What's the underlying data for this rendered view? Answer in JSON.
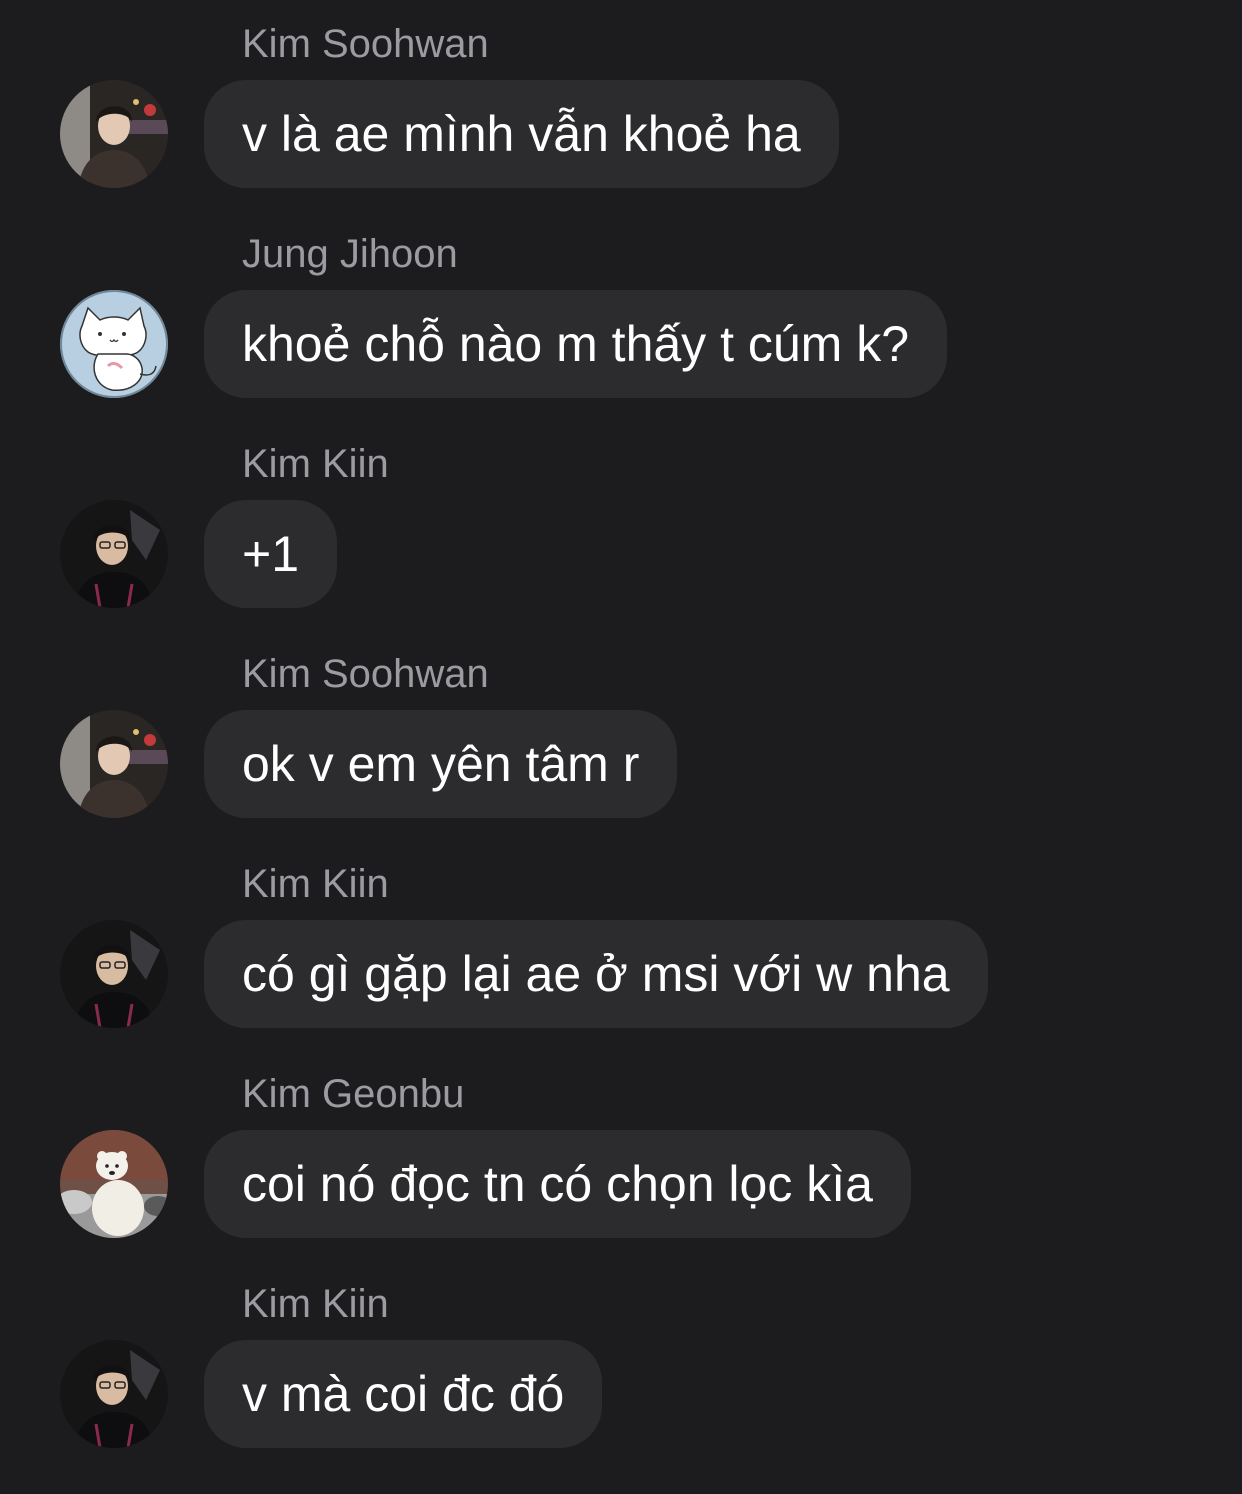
{
  "messages": [
    {
      "sender": "Kim Soohwan",
      "text": "v là ae mình vẫn khoẻ ha",
      "avatar": "avatar-kim-soohwan"
    },
    {
      "sender": "Jung Jihoon",
      "text": "khoẻ chỗ nào m thấy t cúm k?",
      "avatar": "avatar-jung-jihoon"
    },
    {
      "sender": "Kim Kiin",
      "text": "+1",
      "avatar": "avatar-kim-kiin"
    },
    {
      "sender": "Kim Soohwan",
      "text": "ok v em yên tâm r",
      "avatar": "avatar-kim-soohwan"
    },
    {
      "sender": "Kim Kiin",
      "text": "có gì gặp lại ae ở msi với w nha",
      "avatar": "avatar-kim-kiin"
    },
    {
      "sender": "Kim Geonbu",
      "text": "coi nó đọc tn có chọn lọc kìa",
      "avatar": "avatar-kim-geonbu"
    },
    {
      "sender": "Kim Kiin",
      "text": "v mà coi đc đó",
      "avatar": "avatar-kim-kiin"
    }
  ],
  "colors": {
    "background": "#1c1c1e",
    "bubble": "#2c2c2e",
    "sender_name": "#9b9ba1",
    "message_text": "#ffffff"
  }
}
